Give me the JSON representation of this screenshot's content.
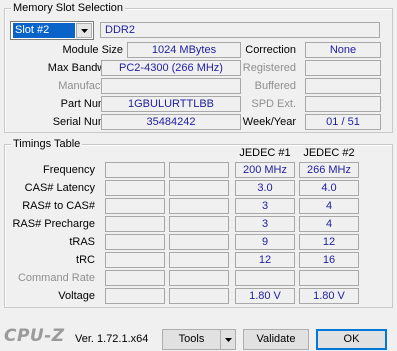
{
  "memory_slot": {
    "group_title": "Memory Slot Selection",
    "slot_selected": "Slot #2",
    "module_type": "DDR2",
    "module_size_label": "Module Size",
    "module_size": "1024 MBytes",
    "max_bandwidth_label": "Max Bandwidth",
    "max_bandwidth": "PC2-4300 (266 MHz)",
    "manufacturer_label": "Manufacturer",
    "manufacturer": "",
    "part_number_label": "Part Number",
    "part_number": "1GBULURTTLBB",
    "serial_number_label": "Serial Number",
    "serial_number": "35484242",
    "correction_label": "Correction",
    "correction": "None",
    "registered_label": "Registered",
    "registered": "",
    "buffered_label": "Buffered",
    "buffered": "",
    "spd_ext_label": "SPD Ext.",
    "spd_ext": "",
    "week_year_label": "Week/Year",
    "week_year": "01 / 51"
  },
  "timings": {
    "group_title": "Timings Table",
    "columns": [
      "",
      "",
      "JEDEC #1",
      "JEDEC #2"
    ],
    "rows": [
      {
        "label": "Frequency",
        "disabled": false,
        "values": [
          "",
          "",
          "200 MHz",
          "266 MHz"
        ]
      },
      {
        "label": "CAS# Latency",
        "disabled": false,
        "values": [
          "",
          "",
          "3.0",
          "4.0"
        ]
      },
      {
        "label": "RAS# to CAS#",
        "disabled": false,
        "values": [
          "",
          "",
          "3",
          "4"
        ]
      },
      {
        "label": "RAS# Precharge",
        "disabled": false,
        "values": [
          "",
          "",
          "3",
          "4"
        ]
      },
      {
        "label": "tRAS",
        "disabled": false,
        "values": [
          "",
          "",
          "9",
          "12"
        ]
      },
      {
        "label": "tRC",
        "disabled": false,
        "values": [
          "",
          "",
          "12",
          "16"
        ]
      },
      {
        "label": "Command Rate",
        "disabled": true,
        "values": [
          "",
          "",
          "",
          ""
        ]
      },
      {
        "label": "Voltage",
        "disabled": false,
        "values": [
          "",
          "",
          "1.80 V",
          "1.80 V"
        ]
      }
    ]
  },
  "footer": {
    "logo": "CPU-Z",
    "version": "Ver. 1.72.1.x64",
    "tools_label": "Tools",
    "validate_label": "Validate",
    "ok_label": "OK"
  },
  "colors": {
    "value_text": "#1e1ea0",
    "selection_bg": "#0a63c8",
    "disabled_text": "#8f8f8f"
  },
  "icons": {
    "combo_arrow": "chevron-down-icon",
    "tools_arrow": "chevron-down-icon"
  }
}
